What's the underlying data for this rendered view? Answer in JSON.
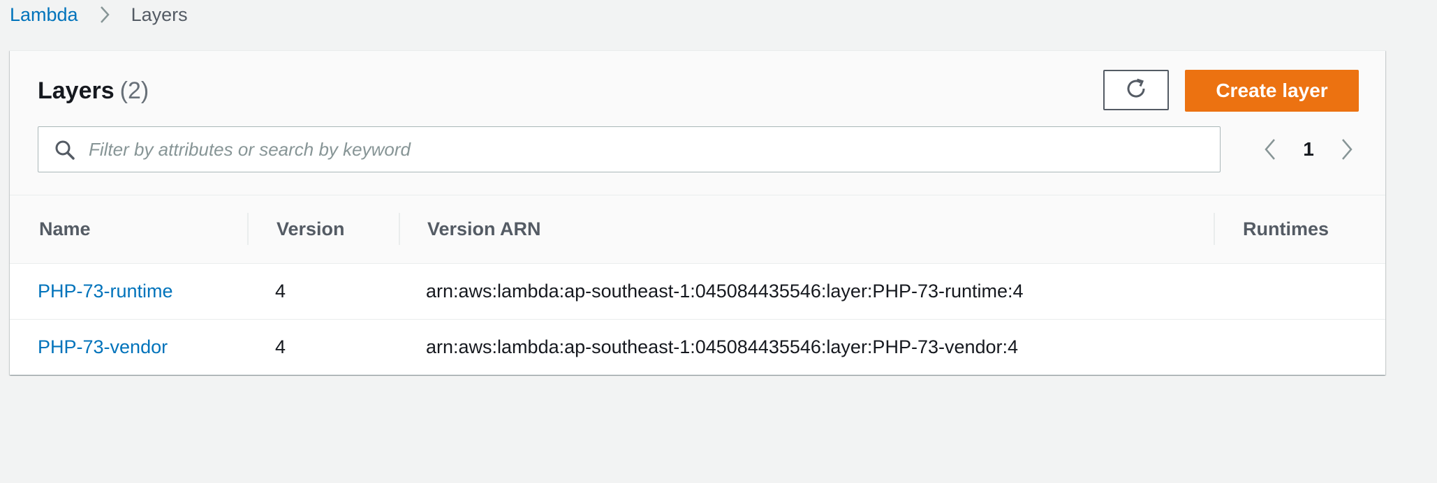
{
  "breadcrumb": {
    "root": "Lambda",
    "current": "Layers"
  },
  "header": {
    "title": "Layers",
    "count": "(2)",
    "create_button": "Create layer",
    "refresh_icon": "refresh-icon"
  },
  "search": {
    "placeholder": "Filter by attributes or search by keyword",
    "value": ""
  },
  "pagination": {
    "current_page": "1"
  },
  "table": {
    "columns": [
      "Name",
      "Version",
      "Version ARN",
      "Runtimes"
    ],
    "rows": [
      {
        "name": "PHP-73-runtime",
        "version": "4",
        "arn": "arn:aws:lambda:ap-southeast-1:045084435546:layer:PHP-73-runtime:4",
        "runtimes": ""
      },
      {
        "name": "PHP-73-vendor",
        "version": "4",
        "arn": "arn:aws:lambda:ap-southeast-1:045084435546:layer:PHP-73-vendor:4",
        "runtimes": ""
      }
    ]
  },
  "colors": {
    "accent": "#ec7211",
    "link": "#0073bb",
    "background": "#f2f3f3"
  }
}
